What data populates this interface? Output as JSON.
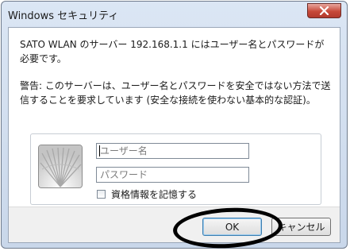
{
  "window": {
    "title": "Windows セキュリティ"
  },
  "message": "SATO WLAN のサーバー 192.168.1.1 にはユーザー名とパスワードが必要です。",
  "warning": "警告: このサーバーは、ユーザー名とパスワードを安全ではない方法で送信することを要求しています (安全な接続を使わない基本的な認証)。",
  "credentials": {
    "username_placeholder": "ユーザー名",
    "username_value": "",
    "password_placeholder": "パスワード",
    "password_value": "",
    "remember_label": "資格情報を記憶する",
    "remember_checked": false,
    "tile_icon": "user-tile-icon"
  },
  "buttons": {
    "ok_label": "OK",
    "cancel_label": "キャンセル"
  },
  "colors": {
    "titlebar": "#d3dfef",
    "close_button": "#c7493a",
    "annotation": "#000000"
  }
}
